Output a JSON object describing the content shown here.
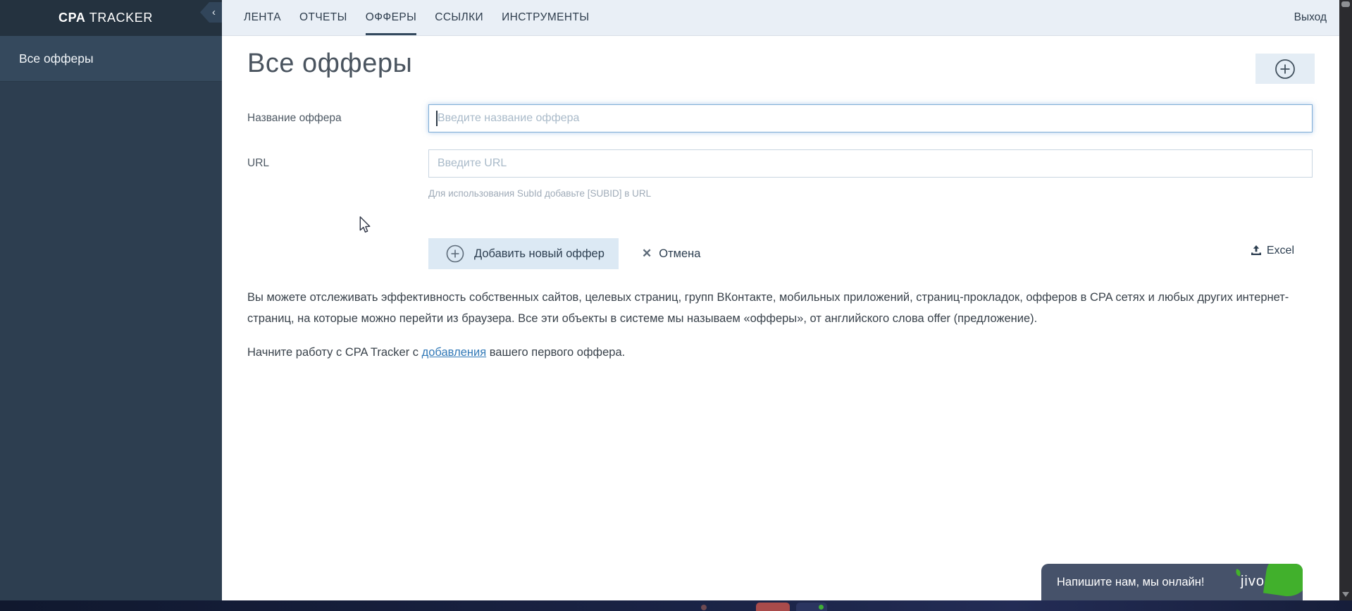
{
  "brand": {
    "bold": "CPA",
    "rest": " TRACKER",
    "collapse_icon": "‹"
  },
  "topnav": {
    "tabs": [
      "ЛЕНТА",
      "ОТЧЕТЫ",
      "ОФФЕРЫ",
      "ССЫЛКИ",
      "ИНСТРУМЕНТЫ"
    ],
    "active_tab": "ОФФЕРЫ",
    "logout": "Выход"
  },
  "sidebar": {
    "items": [
      {
        "label": "Все офферы",
        "active": true
      }
    ]
  },
  "page": {
    "title": "Все офферы"
  },
  "form": {
    "name_label": "Название оффера",
    "name_placeholder": "Введите название оффера",
    "name_value": "",
    "url_label": "URL",
    "url_placeholder": "Введите URL",
    "url_value": "",
    "url_hint": "Для использования SubId добавьте [SUBID] в URL",
    "submit_label": "Добавить новый оффер",
    "cancel_label": "Отмена",
    "cancel_icon": "✕",
    "excel_label": "Excel"
  },
  "description": {
    "paragraph1": "Вы можете отслеживать эффективность собственных сайтов, целевых страниц, групп ВКонтакте, мобильных приложений, страниц-прокладок, офферов в CPA сетях и любых других интернет-страниц, на которые можно перейти из браузера. Все эти объекты в системе мы называем «офферы», от английского слова offer (предложение).",
    "paragraph2_before": "Начните работу с CPA Tracker с ",
    "paragraph2_link": "добавления",
    "paragraph2_after": " вашего первого оффера."
  },
  "chat": {
    "message": "Напишите нам, мы онлайн!",
    "brand": "jivo"
  },
  "colors": {
    "sidebar_bg": "#2d3e50",
    "sidebar_header_bg": "#24323f",
    "sidebar_active_bg": "#35495d",
    "topnav_bg": "#e9eff6",
    "accent_navy": "#34495e",
    "button_bg": "#dce9f4",
    "link_blue": "#3279b7",
    "focused_border": "#7fadd6",
    "jivo_bg": "#46526a",
    "jivo_green": "#41b02c"
  }
}
